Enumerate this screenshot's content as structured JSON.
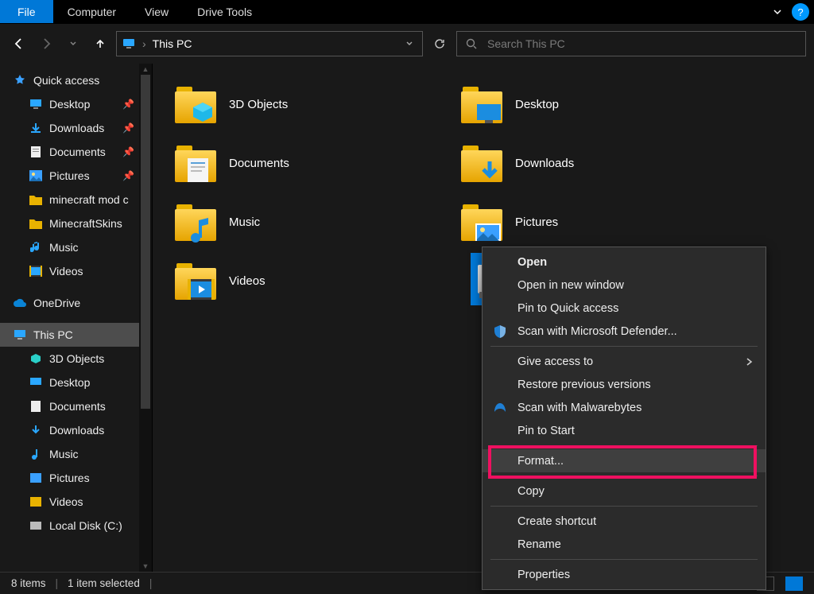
{
  "ribbon": {
    "tabs": [
      "File",
      "Computer",
      "View",
      "Drive Tools"
    ]
  },
  "address": {
    "location": "This PC",
    "search_placeholder": "Search This PC"
  },
  "sidebar": {
    "quick_access": "Quick access",
    "items": [
      {
        "label": "Desktop",
        "pinned": true
      },
      {
        "label": "Downloads",
        "pinned": true
      },
      {
        "label": "Documents",
        "pinned": true
      },
      {
        "label": "Pictures",
        "pinned": true
      },
      {
        "label": "minecraft mod c",
        "pinned": false
      },
      {
        "label": "MinecraftSkins",
        "pinned": false
      },
      {
        "label": "Music",
        "pinned": false
      },
      {
        "label": "Videos",
        "pinned": false
      }
    ],
    "onedrive": "OneDrive",
    "this_pc": "This PC",
    "pc_items": [
      {
        "label": "3D Objects"
      },
      {
        "label": "Desktop"
      },
      {
        "label": "Documents"
      },
      {
        "label": "Downloads"
      },
      {
        "label": "Music"
      },
      {
        "label": "Pictures"
      },
      {
        "label": "Videos"
      },
      {
        "label": "Local Disk (C:)"
      }
    ]
  },
  "folders": [
    {
      "label": "3D Objects"
    },
    {
      "label": "Desktop"
    },
    {
      "label": "Documents"
    },
    {
      "label": "Downloads"
    },
    {
      "label": "Music"
    },
    {
      "label": "Pictures"
    },
    {
      "label": "Videos"
    }
  ],
  "context_menu": {
    "items": [
      {
        "label": "Open",
        "bold": true
      },
      {
        "label": "Open in new window"
      },
      {
        "label": "Pin to Quick access"
      },
      {
        "label": "Scan with Microsoft Defender...",
        "icon": "defender"
      },
      {
        "sep": true
      },
      {
        "label": "Give access to",
        "submenu": true
      },
      {
        "label": "Restore previous versions"
      },
      {
        "label": "Scan with Malwarebytes",
        "icon": "malwarebytes"
      },
      {
        "label": "Pin to Start"
      },
      {
        "sep": true
      },
      {
        "label": "Format...",
        "highlight": true
      },
      {
        "sep": true
      },
      {
        "label": "Copy"
      },
      {
        "sep": true
      },
      {
        "label": "Create shortcut"
      },
      {
        "label": "Rename"
      },
      {
        "sep": true
      },
      {
        "label": "Properties"
      }
    ]
  },
  "status": {
    "count": "8 items",
    "selected": "1 item selected"
  }
}
